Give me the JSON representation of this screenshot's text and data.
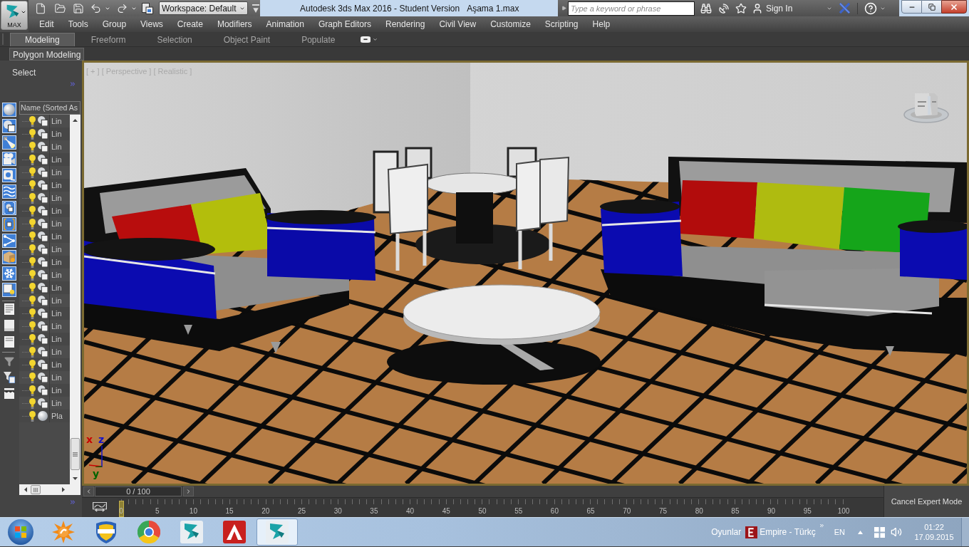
{
  "app_button": {
    "label": "MAX"
  },
  "quick_access": {
    "workspace": "Workspace: Default"
  },
  "window": {
    "title": "Autodesk 3ds Max 2016 - Student Version",
    "document": "Aşama 1.max"
  },
  "infocenter": {
    "search": {
      "placeholder": "Type a keyword or phrase"
    },
    "sign_in": "Sign In"
  },
  "menu": [
    "Edit",
    "Tools",
    "Group",
    "Views",
    "Create",
    "Modifiers",
    "Animation",
    "Graph Editors",
    "Rendering",
    "Civil View",
    "Customize",
    "Scripting",
    "Help"
  ],
  "ribbon": {
    "tabs": [
      {
        "label": "Modeling",
        "selected": true
      },
      {
        "label": "Freeform",
        "selected": false
      },
      {
        "label": "Selection",
        "selected": false
      },
      {
        "label": "Object Paint",
        "selected": false
      },
      {
        "label": "Populate",
        "selected": false
      }
    ],
    "panel": "Polygon Modeling"
  },
  "scene_explorer": {
    "title": "Select",
    "column": "Name (Sorted As",
    "filters": [
      {
        "kind": "geometry",
        "on": true
      },
      {
        "kind": "shapes",
        "on": true
      },
      {
        "kind": "lights",
        "on": true
      },
      {
        "kind": "cameras",
        "on": true
      },
      {
        "kind": "helpers",
        "on": true
      },
      {
        "kind": "spacewarps",
        "on": true
      },
      {
        "kind": "groups",
        "on": true
      },
      {
        "kind": "xrefs",
        "on": true
      },
      {
        "kind": "bones",
        "on": true
      },
      {
        "kind": "containers",
        "on": true
      },
      {
        "kind": "frozen",
        "on": true
      },
      {
        "kind": "hidden",
        "on": true
      }
    ],
    "rows": [
      {
        "name": "Lin",
        "kind": "shape",
        "visible": true
      },
      {
        "name": "Lin",
        "kind": "shape",
        "visible": true
      },
      {
        "name": "Lin",
        "kind": "shape",
        "visible": true
      },
      {
        "name": "Lin",
        "kind": "shape",
        "visible": true
      },
      {
        "name": "Lin",
        "kind": "shape",
        "visible": true
      },
      {
        "name": "Lin",
        "kind": "shape",
        "visible": true
      },
      {
        "name": "Lin",
        "kind": "shape",
        "visible": true
      },
      {
        "name": "Lin",
        "kind": "shape",
        "visible": true
      },
      {
        "name": "Lin",
        "kind": "shape",
        "visible": true
      },
      {
        "name": "Lin",
        "kind": "shape",
        "visible": true
      },
      {
        "name": "Lin",
        "kind": "shape",
        "visible": true
      },
      {
        "name": "Lin",
        "kind": "shape",
        "visible": true
      },
      {
        "name": "Lin",
        "kind": "shape",
        "visible": true
      },
      {
        "name": "Lin",
        "kind": "shape",
        "visible": true
      },
      {
        "name": "Lin",
        "kind": "shape",
        "visible": true
      },
      {
        "name": "Lin",
        "kind": "shape",
        "visible": true
      },
      {
        "name": "Lin",
        "kind": "shape",
        "visible": true
      },
      {
        "name": "Lin",
        "kind": "shape",
        "visible": true
      },
      {
        "name": "Lin",
        "kind": "shape",
        "visible": true
      },
      {
        "name": "Lin",
        "kind": "shape",
        "visible": true
      },
      {
        "name": "Lin",
        "kind": "shape",
        "visible": true
      },
      {
        "name": "Lin",
        "kind": "shape",
        "visible": true
      },
      {
        "name": "Lin",
        "kind": "shape",
        "visible": true
      },
      {
        "name": "Pla",
        "kind": "geometry",
        "visible": true
      }
    ]
  },
  "viewport": {
    "label": "[ + ] [ Perspective ] [ Realistic ]",
    "axes": [
      {
        "label": "x",
        "color": "#c80000"
      },
      {
        "label": "z",
        "color": "#1414c8"
      },
      {
        "label": "y",
        "color": "#006400"
      }
    ]
  },
  "time_slider": {
    "reading": "0 / 100",
    "level": 0
  },
  "timeline": {
    "labels": [
      "0",
      "5",
      "10",
      "15",
      "20",
      "25",
      "30",
      "35",
      "40",
      "45",
      "50",
      "55",
      "60",
      "65",
      "70",
      "75",
      "80",
      "85",
      "90",
      "95",
      "100"
    ]
  },
  "expert_mode": {
    "button": "Cancel Expert Mode"
  },
  "taskbar": {
    "apps": [
      {
        "kind": "splat",
        "active": false
      },
      {
        "kind": "shield",
        "active": false
      },
      {
        "kind": "browser",
        "active": false
      },
      {
        "kind": "swirl",
        "active": false
      },
      {
        "kind": "triangle",
        "active": false
      },
      {
        "kind": "swirl",
        "active": true
      }
    ],
    "toolbar": "Oyunlar",
    "window": "Empire - Türkç",
    "language": "EN",
    "time": "01:22",
    "date": "17.09.2015"
  }
}
